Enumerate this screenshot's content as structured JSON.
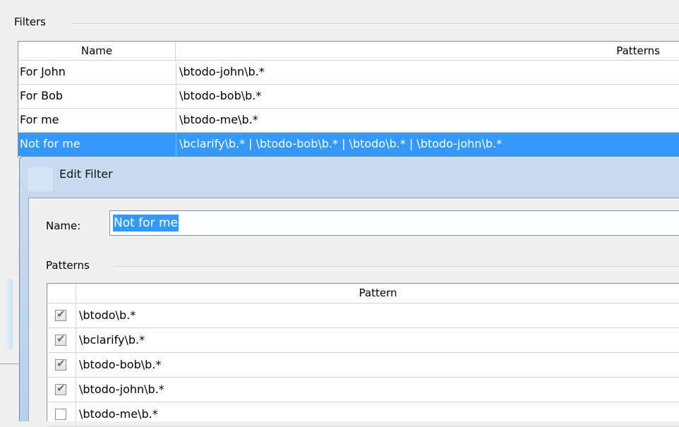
{
  "filters": {
    "group_title": "Filters",
    "columns": [
      "Name",
      "Patterns"
    ],
    "rows": [
      {
        "name": "For John",
        "patterns": "\\btodo-john\\b.*",
        "selected": false
      },
      {
        "name": "For Bob",
        "patterns": "\\btodo-bob\\b.*",
        "selected": false
      },
      {
        "name": "For me",
        "patterns": "\\btodo-me\\b.*",
        "selected": false
      },
      {
        "name": "Not for me",
        "patterns": "\\bclarify\\b.* | \\btodo-bob\\b.* | \\btodo\\b.* | \\btodo-john\\b.*",
        "selected": true
      }
    ]
  },
  "dialog": {
    "title": "Edit Filter",
    "name_label": "Name:",
    "name_value": "Not for me",
    "patterns_title": "Patterns",
    "pattern_column": "Pattern",
    "patterns": [
      {
        "text": "\\btodo\\b.*",
        "checked": true
      },
      {
        "text": "\\bclarify\\b.*",
        "checked": true
      },
      {
        "text": "\\btodo-bob\\b.*",
        "checked": true
      },
      {
        "text": "\\btodo-john\\b.*",
        "checked": true
      },
      {
        "text": "\\btodo-me\\b.*",
        "checked": false
      }
    ]
  },
  "colors": {
    "selection": "#3399ff",
    "title_bar": "#c9dcf0"
  }
}
